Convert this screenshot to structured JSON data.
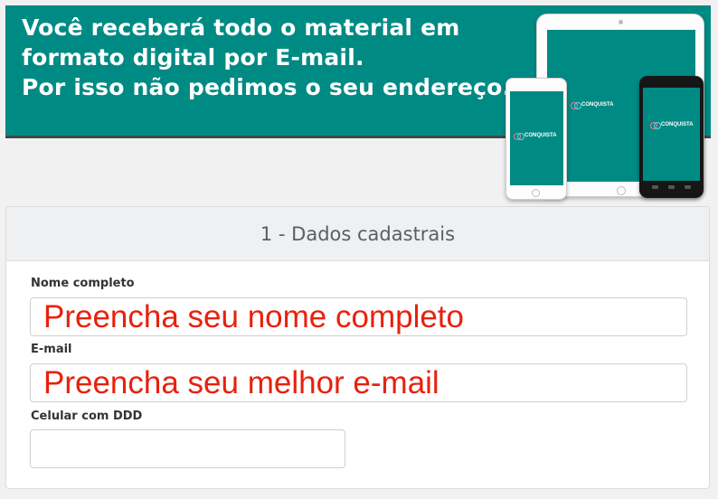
{
  "banner": {
    "lines": [
      "Você receberá todo o material em",
      "formato digital por E-mail.",
      "Por isso não pedimos o seu endereço."
    ],
    "background_color": "#008a84",
    "devices_logo_text": "CONQUISTA"
  },
  "form": {
    "section_title": "1 - Dados cadastrais",
    "fields": [
      {
        "label": "Nome completo",
        "placeholder": "Preencha seu nome completo",
        "value": ""
      },
      {
        "label": "E-mail",
        "placeholder": "Preencha seu melhor e-mail",
        "value": ""
      },
      {
        "label": "Celular com DDD",
        "placeholder": "",
        "value": ""
      }
    ],
    "placeholder_color": "#e8210d"
  }
}
